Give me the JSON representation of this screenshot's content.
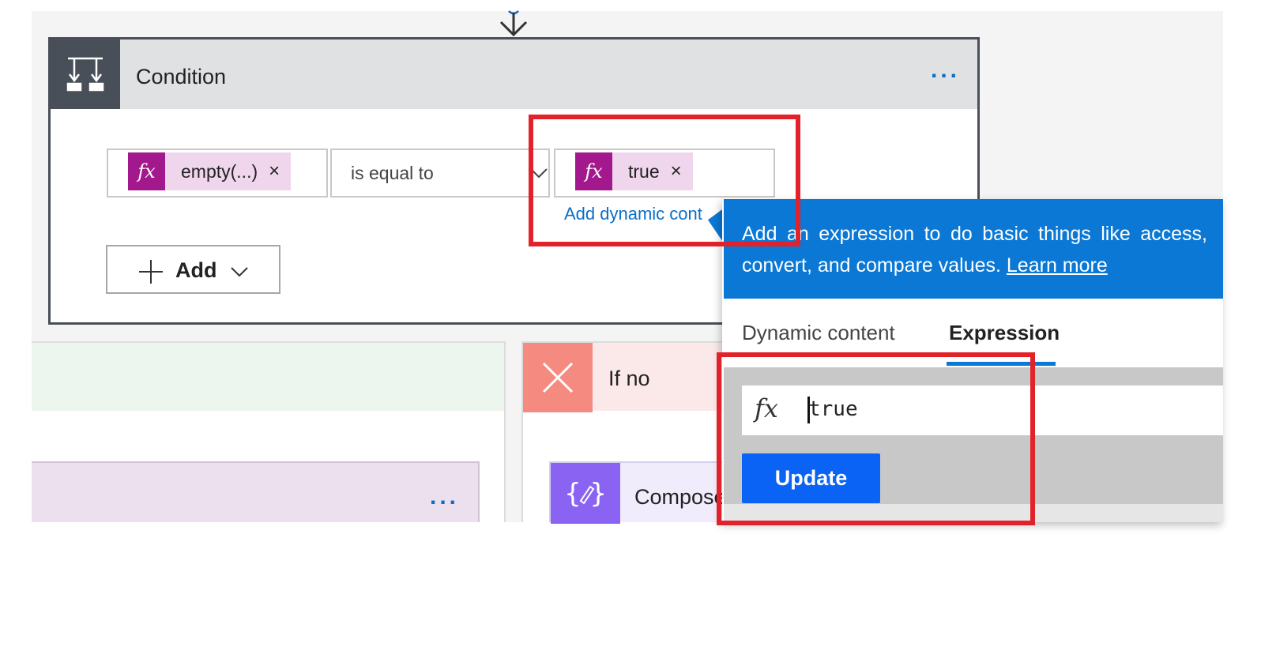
{
  "condition": {
    "title": "Condition",
    "more_label": "...",
    "left_operand": {
      "fx": "fx",
      "label": "empty(...)",
      "remove": "×"
    },
    "operator": {
      "value": "is equal to"
    },
    "right_operand": {
      "fx": "fx",
      "label": "true",
      "remove": "×"
    },
    "add_dynamic_link": "Add dynamic cont",
    "add_button": "Add"
  },
  "branches": {
    "yes": {
      "more_label": "..."
    },
    "no": {
      "title": "If no",
      "compose_title": "Compose"
    }
  },
  "popup": {
    "info_text": "Add an expression to do basic things like access, convert, and compare values. ",
    "learn_more": "Learn more",
    "tabs": [
      {
        "label": "Dynamic content",
        "active": false
      },
      {
        "label": "Expression",
        "active": true
      }
    ],
    "expression": {
      "fx": "fx",
      "value": "true"
    },
    "update_button": "Update"
  },
  "colors": {
    "accent": "#0a78d4",
    "fx_token": "#a3188c",
    "highlight": "#e2222a",
    "no_branch": "#f58a80",
    "compose": "#8a63f2"
  },
  "icons": [
    "connector-arrow-icon",
    "condition-icon",
    "more-icon",
    "fx-icon",
    "close-icon",
    "chevron-down-icon",
    "plus-icon",
    "x-icon",
    "compose-icon"
  ]
}
